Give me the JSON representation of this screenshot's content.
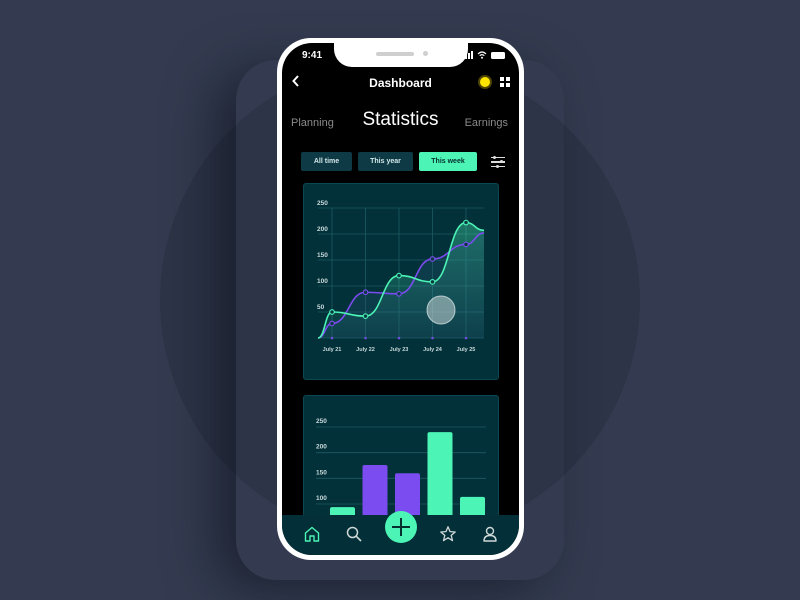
{
  "status_bar": {
    "time": "9:41"
  },
  "header": {
    "title": "Dashboard",
    "back_icon": "chevron-left-icon",
    "theme_icon": "sun-icon",
    "layout_icon": "grid-icon"
  },
  "tabs": [
    {
      "label": "Planning",
      "active": false
    },
    {
      "label": "Statistics",
      "active": true
    },
    {
      "label": "Earnings",
      "active": false
    }
  ],
  "filters": [
    {
      "label": "All time",
      "active": false
    },
    {
      "label": "This year",
      "active": false
    },
    {
      "label": "This week",
      "active": true
    }
  ],
  "colors": {
    "accent_green": "#4cf4b6",
    "accent_purple": "#7b4cf0",
    "card_bg": "#03313a",
    "page_bg": "#343b50"
  },
  "chart_data": [
    {
      "type": "line",
      "title": "",
      "xlabel": "",
      "ylabel": "",
      "categories": [
        "July 21",
        "July 22",
        "July 23",
        "July 24",
        "July 25"
      ],
      "ylim": [
        0,
        250
      ],
      "yticks": [
        50,
        100,
        150,
        200,
        250
      ],
      "grid": true,
      "series": [
        {
          "name": "green",
          "color": "#4cf4b6",
          "values": [
            50,
            42,
            120,
            108,
            222
          ]
        },
        {
          "name": "purple",
          "color": "#7b4cf0",
          "values": [
            28,
            88,
            85,
            152,
            180
          ]
        }
      ]
    },
    {
      "type": "bar",
      "title": "",
      "xlabel": "",
      "ylabel": "",
      "ylim": [
        0,
        250
      ],
      "yticks": [
        100,
        150,
        200,
        250
      ],
      "grid": true,
      "values": [
        90,
        172,
        156,
        236,
        110
      ],
      "bar_colors": [
        "#4cf4b6",
        "#7b4cf0",
        "#7b4cf0",
        "#4cf4b6",
        "#4cf4b6"
      ]
    }
  ],
  "navbar": {
    "items": [
      {
        "name": "home",
        "icon": "home-icon",
        "active": true
      },
      {
        "name": "search",
        "icon": "search-icon",
        "active": false
      },
      {
        "name": "add",
        "icon": "plus-icon",
        "active": false
      },
      {
        "name": "favorites",
        "icon": "star-icon",
        "active": false
      },
      {
        "name": "profile",
        "icon": "user-icon",
        "active": false
      }
    ]
  }
}
